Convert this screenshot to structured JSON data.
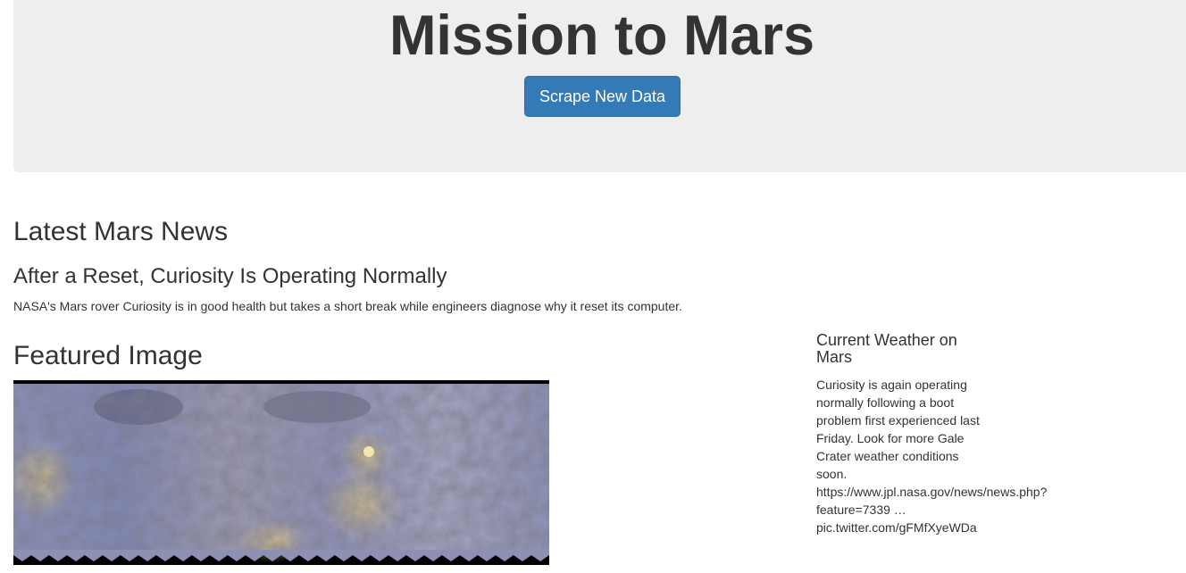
{
  "header": {
    "title": "Mission to Mars",
    "scrape_button_label": "Scrape New Data"
  },
  "news": {
    "section_title": "Latest Mars News",
    "headline": "After a Reset, Curiosity Is Operating Normally",
    "teaser": "NASA's Mars rover Curiosity is in good health but takes a short break while engineers diagnose why it reset its computer."
  },
  "featured": {
    "section_title": "Featured Image"
  },
  "weather": {
    "section_title": "Current Weather on\nMars",
    "text": "Curiosity is again operating\nnormally following a boot\nproblem first experienced last\nFriday. Look for more Gale\nCrater weather conditions soon.\nhttps://www.jpl.nasa.gov/news/news.php?\nfeature=7339 …\npic.twitter.com/gFMfXyeWDa"
  },
  "colors": {
    "jumbotron_bg": "#eeeeee",
    "primary_button": "#337ab7",
    "text": "#333333"
  }
}
